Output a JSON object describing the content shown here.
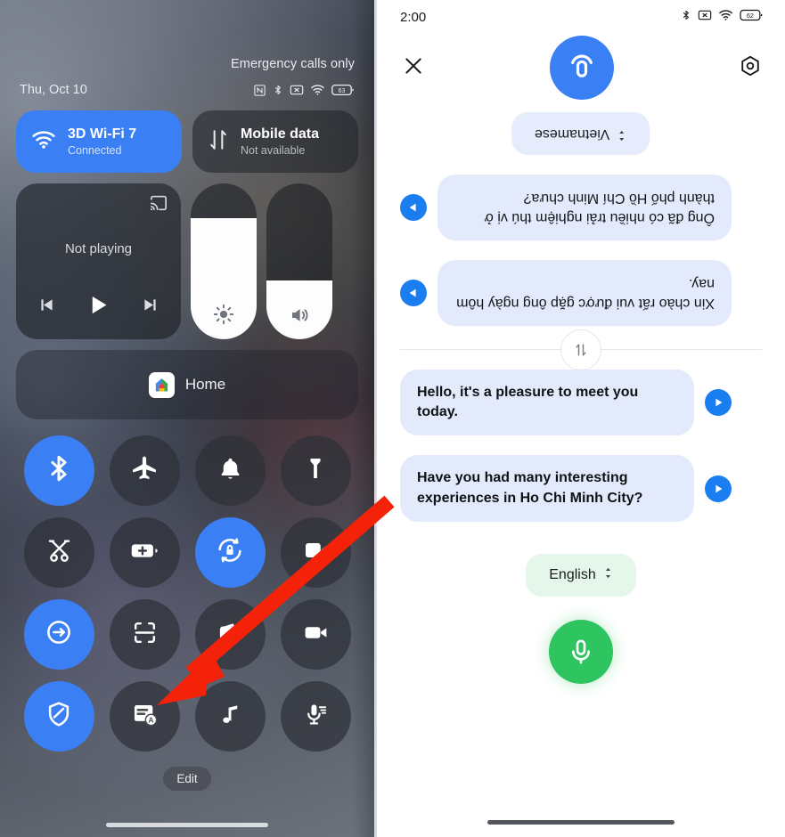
{
  "quick_settings": {
    "status_bar": {
      "carrier_text": "Emergency calls only",
      "date": "Thu, Oct 10",
      "battery_percent": "63",
      "icons": [
        "nfc-icon",
        "bluetooth-icon",
        "no-sim-icon",
        "wifi-icon",
        "battery-icon"
      ]
    },
    "connectivity": [
      {
        "name": "wifi",
        "title": "3D Wi-Fi 7",
        "subtitle": "Connected",
        "active": true,
        "icon": "wifi-icon"
      },
      {
        "name": "mobile-data",
        "title": "Mobile data",
        "subtitle": "Not available",
        "active": false,
        "icon": "mobile-data-icon"
      }
    ],
    "media": {
      "status": "Not playing",
      "cast_icon": "cast-icon",
      "prev_icon": "previous-track-icon",
      "play_icon": "play-icon",
      "next_icon": "next-track-icon"
    },
    "sliders": [
      {
        "name": "brightness",
        "icon": "brightness-icon",
        "level": 78
      },
      {
        "name": "volume",
        "icon": "volume-icon",
        "level": 38
      }
    ],
    "home_tile": {
      "label": "Home",
      "icon": "google-home-icon"
    },
    "toggles": [
      {
        "name": "bluetooth",
        "icon": "bluetooth-icon",
        "active": true
      },
      {
        "name": "airplane-mode",
        "icon": "airplane-icon",
        "active": false
      },
      {
        "name": "ring-mode",
        "icon": "bell-icon",
        "active": false
      },
      {
        "name": "flashlight",
        "icon": "flashlight-icon",
        "active": false
      },
      {
        "name": "screenshot",
        "icon": "scissors-icon",
        "active": false
      },
      {
        "name": "battery-saver",
        "icon": "battery-plus-icon",
        "active": false
      },
      {
        "name": "auto-rotate",
        "icon": "rotation-lock-icon",
        "active": true
      },
      {
        "name": "screen-record",
        "icon": "screen-record-icon",
        "active": false
      },
      {
        "name": "data-saver",
        "icon": "sync-icon",
        "active": true
      },
      {
        "name": "qr-scanner",
        "icon": "scan-frame-icon",
        "active": false
      },
      {
        "name": "wallet",
        "icon": "wallet-icon",
        "active": false
      },
      {
        "name": "video-call",
        "icon": "video-camera-icon",
        "active": false
      },
      {
        "name": "vpn-shield",
        "icon": "shield-icon",
        "active": true
      },
      {
        "name": "interpreter",
        "icon": "interpreter-icon",
        "active": false
      },
      {
        "name": "music",
        "icon": "music-note-icon",
        "active": false
      },
      {
        "name": "voice-recorder",
        "icon": "recorder-mic-icon",
        "active": false
      }
    ],
    "edit_label": "Edit"
  },
  "interpreter": {
    "status_bar": {
      "time": "2:00",
      "battery_percent": "62",
      "icons": [
        "bluetooth-icon",
        "no-sim-icon",
        "wifi-icon",
        "battery-icon"
      ]
    },
    "close_icon": "close-icon",
    "settings_icon": "gear-icon",
    "app_logo_icon": "interpreter-logo-icon",
    "remote": {
      "language": "Vietnamese",
      "chevron_icon": "chevron-updown-icon",
      "messages": [
        {
          "text": "Ông đã có nhiều trải nghiệm thú vị ở thành phố Hồ Chí Minh chưa?",
          "play_icon": "play-audio-icon"
        },
        {
          "text": "Xin chào rất vui được gặp ông ngày hôm nay.",
          "play_icon": "play-audio-icon"
        }
      ]
    },
    "swap_icon": "swap-vertical-icon",
    "local": {
      "language": "English",
      "chevron_icon": "chevron-updown-icon",
      "messages": [
        {
          "text": "Hello, it's a pleasure to meet you today.",
          "play_icon": "play-audio-icon"
        },
        {
          "text": "Have you had many interesting experiences in Ho Chi Minh City?",
          "play_icon": "play-audio-icon"
        }
      ],
      "mic_icon": "microphone-icon"
    }
  },
  "annotation": {
    "arrow_color": "#f42208",
    "name": "pointer-arrow"
  }
}
